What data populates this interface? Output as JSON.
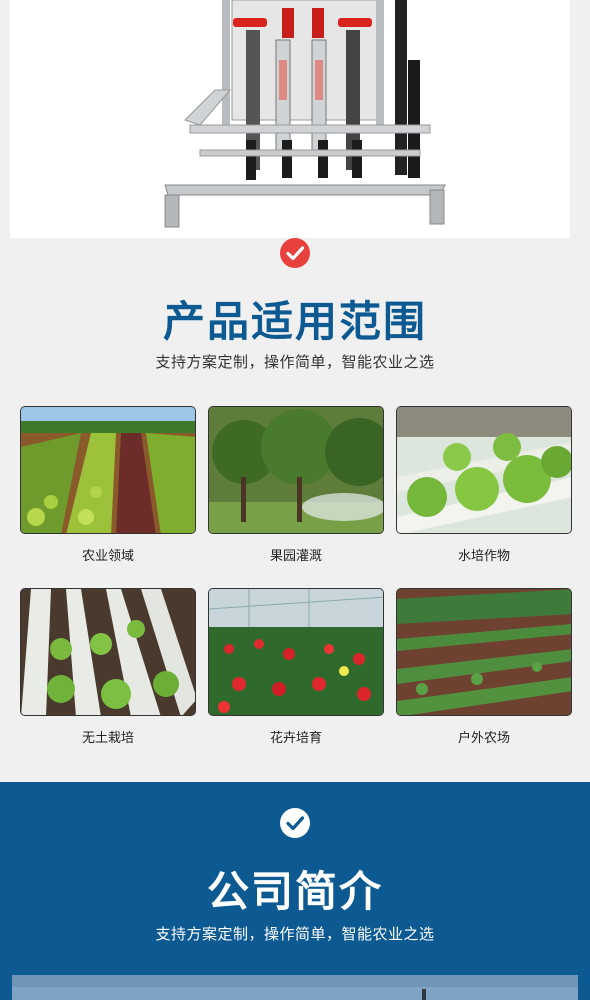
{
  "section_scope": {
    "title": "产品适用范围",
    "subtitle": "支持方案定制，操作简单，智能农业之选",
    "check_color": "#e8413d",
    "title_color": "#0d5a93",
    "items": [
      {
        "label": "农业领域",
        "image": "vegetable-field-image"
      },
      {
        "label": "果园灌溉",
        "image": "orchard-mist-image"
      },
      {
        "label": "水培作物",
        "image": "hydroponic-lettuce-image"
      },
      {
        "label": "无土栽培",
        "image": "soilless-culture-image"
      },
      {
        "label": "花卉培育",
        "image": "anthurium-greenhouse-image"
      },
      {
        "label": "户外农场",
        "image": "outdoor-farm-image"
      }
    ]
  },
  "section_company": {
    "title": "公司简介",
    "subtitle": "支持方案定制，操作简单，智能农业之选",
    "background": "#0d5a93"
  }
}
